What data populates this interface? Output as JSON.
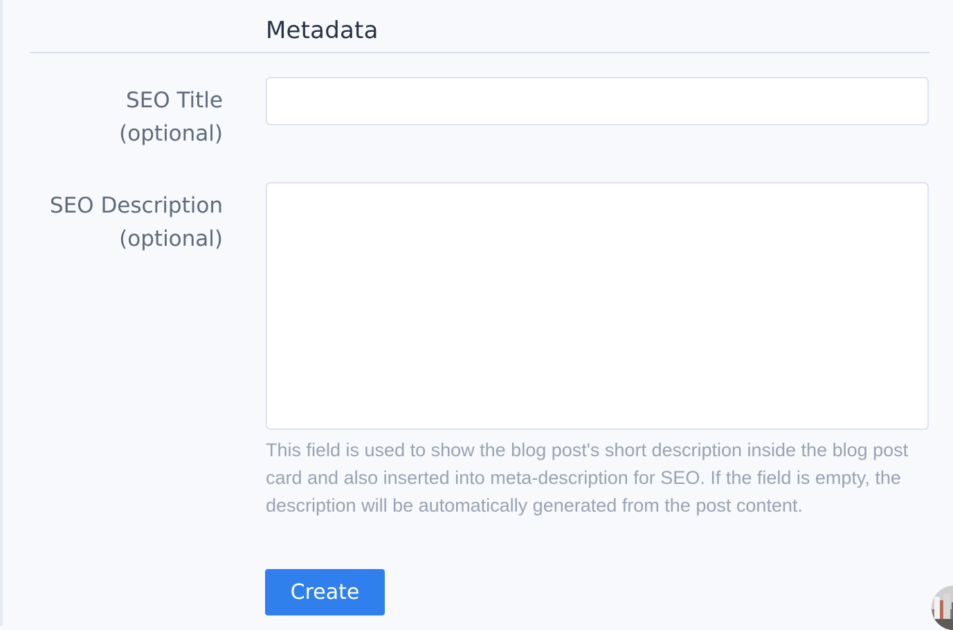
{
  "metadata": {
    "title": "Metadata"
  },
  "fields": {
    "seo_title": {
      "label": "SEO Title (optional)",
      "value": "",
      "placeholder": ""
    },
    "seo_description": {
      "label": "SEO Description (optional)",
      "value": "",
      "placeholder": "",
      "help": "This field is used to show the blog post's short description inside the blog post card and also inserted into meta-description for SEO. If the field is empty, the description will be automatically generated from the post content."
    }
  },
  "actions": {
    "create_label": "Create"
  },
  "colors": {
    "primary": "#2f80ed",
    "background": "#f7f9fc",
    "border": "#dce4ef",
    "label": "#5f6b7d",
    "help_text": "#99a3b3"
  },
  "icons": {
    "avatar": "avatar-image"
  }
}
